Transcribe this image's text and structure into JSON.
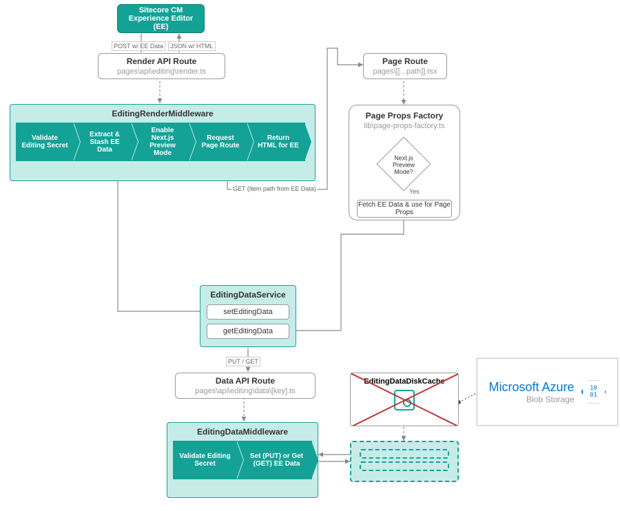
{
  "nodes": {
    "sitecore_cm": "Sitecore CM\nExperience Editor (EE)",
    "render_api": {
      "title": "Render API Route",
      "sub": "pages\\api\\editing\\render.ts"
    },
    "page_route": {
      "title": "Page Route",
      "sub": "pages\\[[...path]].tsx"
    },
    "editing_render_mw": "EditingRenderMiddleware",
    "page_props_factory": {
      "title": "Page Props Factory",
      "sub": "lib\\page-props-factory.ts"
    },
    "editing_data_service": "EditingDataService",
    "data_api_route": {
      "title": "Data API Route",
      "sub": "pages\\api\\editing\\data\\[key].ts"
    },
    "editing_data_mw": "EditingDataMiddleware",
    "editing_data_disk_cache": "EditingDataDiskCache"
  },
  "chevrons_render": [
    "Validate Editing Secret",
    "Extract & Stash EE Data",
    "Enable Next.js Preview Mode",
    "Request Page Route",
    "Return HTML for EE"
  ],
  "chevrons_data": [
    "Validate Editing Secret",
    "Set (PUT) or Get (GET) EE Data"
  ],
  "service_methods": {
    "set": "setEditingData",
    "get": "getEditingData"
  },
  "decision": "Next.js Preview Mode?",
  "decision_yes": "Yes",
  "fetch_ee": "Fetch EE Data & use for Page Props",
  "edge_labels": {
    "post_ee": "POST w/ EE Data",
    "json_html": "JSON w/ HTML",
    "get_item_path": "GET (Item path from EE Data)",
    "put_get": "PUT / GET"
  },
  "azure": {
    "main": "Microsoft Azure",
    "sub": "Blob Storage",
    "icon": "10\n01"
  }
}
